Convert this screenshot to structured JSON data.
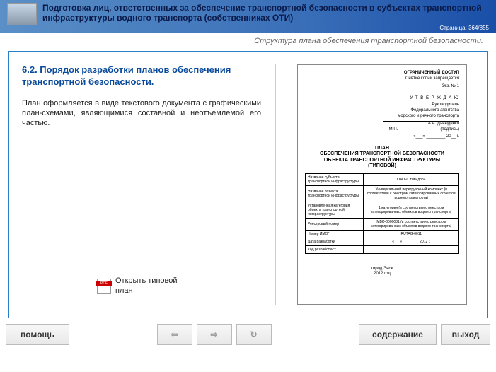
{
  "header": {
    "title": "Подготовка лиц, ответственных за обеспечение транспортной безопасности в субъектах транспортной инфраструктуры водного транспорта (собственниках ОТИ)",
    "page_label": "Страница: 364/855"
  },
  "subtitle": "Структура плана обеспечения транспортной безопасности.",
  "section": {
    "title": "6.2. Порядок разработки планов обеспечения транспортной безопасности.",
    "body": "План оформляется в виде текстового документа с графическими план-схемами, являющимися составной и неотъемлемой его частью.",
    "open_label": "Открыть типовой план"
  },
  "doc": {
    "restricted": "ОГРАНИЧЕННЫЙ ДОСТУП",
    "copies": "Снятие копий запрещается",
    "exn": "Экз. № 1",
    "approve": "У Т В Е Р Ж Д А Ю",
    "approve_pos1": "Руководитель",
    "approve_pos2": "Федерального агентства",
    "approve_pos3": "морского и речного транспорта",
    "signer": "А.А. Давыденко",
    "sign_lbl": "(подпись)",
    "mp": "М.П.",
    "date": "«___» ________ 20__ г.",
    "plan_l1": "ПЛАН",
    "plan_l2": "ОБЕСПЕЧЕНИЯ ТРАНСПОРТНОЙ БЕЗОПАСНОСТИ",
    "plan_l3": "ОБЪЕКТА ТРАНСПОРТНОЙ ИНФРАСТРУКТУРЫ",
    "plan_l4": "(ТИПОВОЙ)",
    "rows": [
      {
        "l": "Название субъекта транспортной инфраструктуры",
        "r": "ОАО «Стивидор»"
      },
      {
        "l": "Название объекта транспортной инфраструктуры",
        "r": "Универсальный перегрузочный комплекс (в соответствии с реестром категорированных объектов водного транспорта)"
      },
      {
        "l": "Установленная категория объекта транспортной инфраструктуры",
        "r": "1 категория (в соответствии с реестром категорированных объектов водного транспорта)"
      },
      {
        "l": "Реестровый номер",
        "r": "МВО-0000081 (в соответствии с реестром категорированных объектов водного транспорта)"
      },
      {
        "l": "Номер ИМО*",
        "r": "RUTAG-0011"
      },
      {
        "l": "Дата разработки",
        "r": "«___» ________ 2012 г."
      },
      {
        "l": "Код разработки**",
        "r": ""
      }
    ],
    "footer1": "город Энск",
    "footer2": "2012 год"
  },
  "buttons": {
    "help": "помощь",
    "prev": "⇦",
    "next": "⇨",
    "refresh": "↻",
    "toc": "содержание",
    "exit": "выход"
  }
}
